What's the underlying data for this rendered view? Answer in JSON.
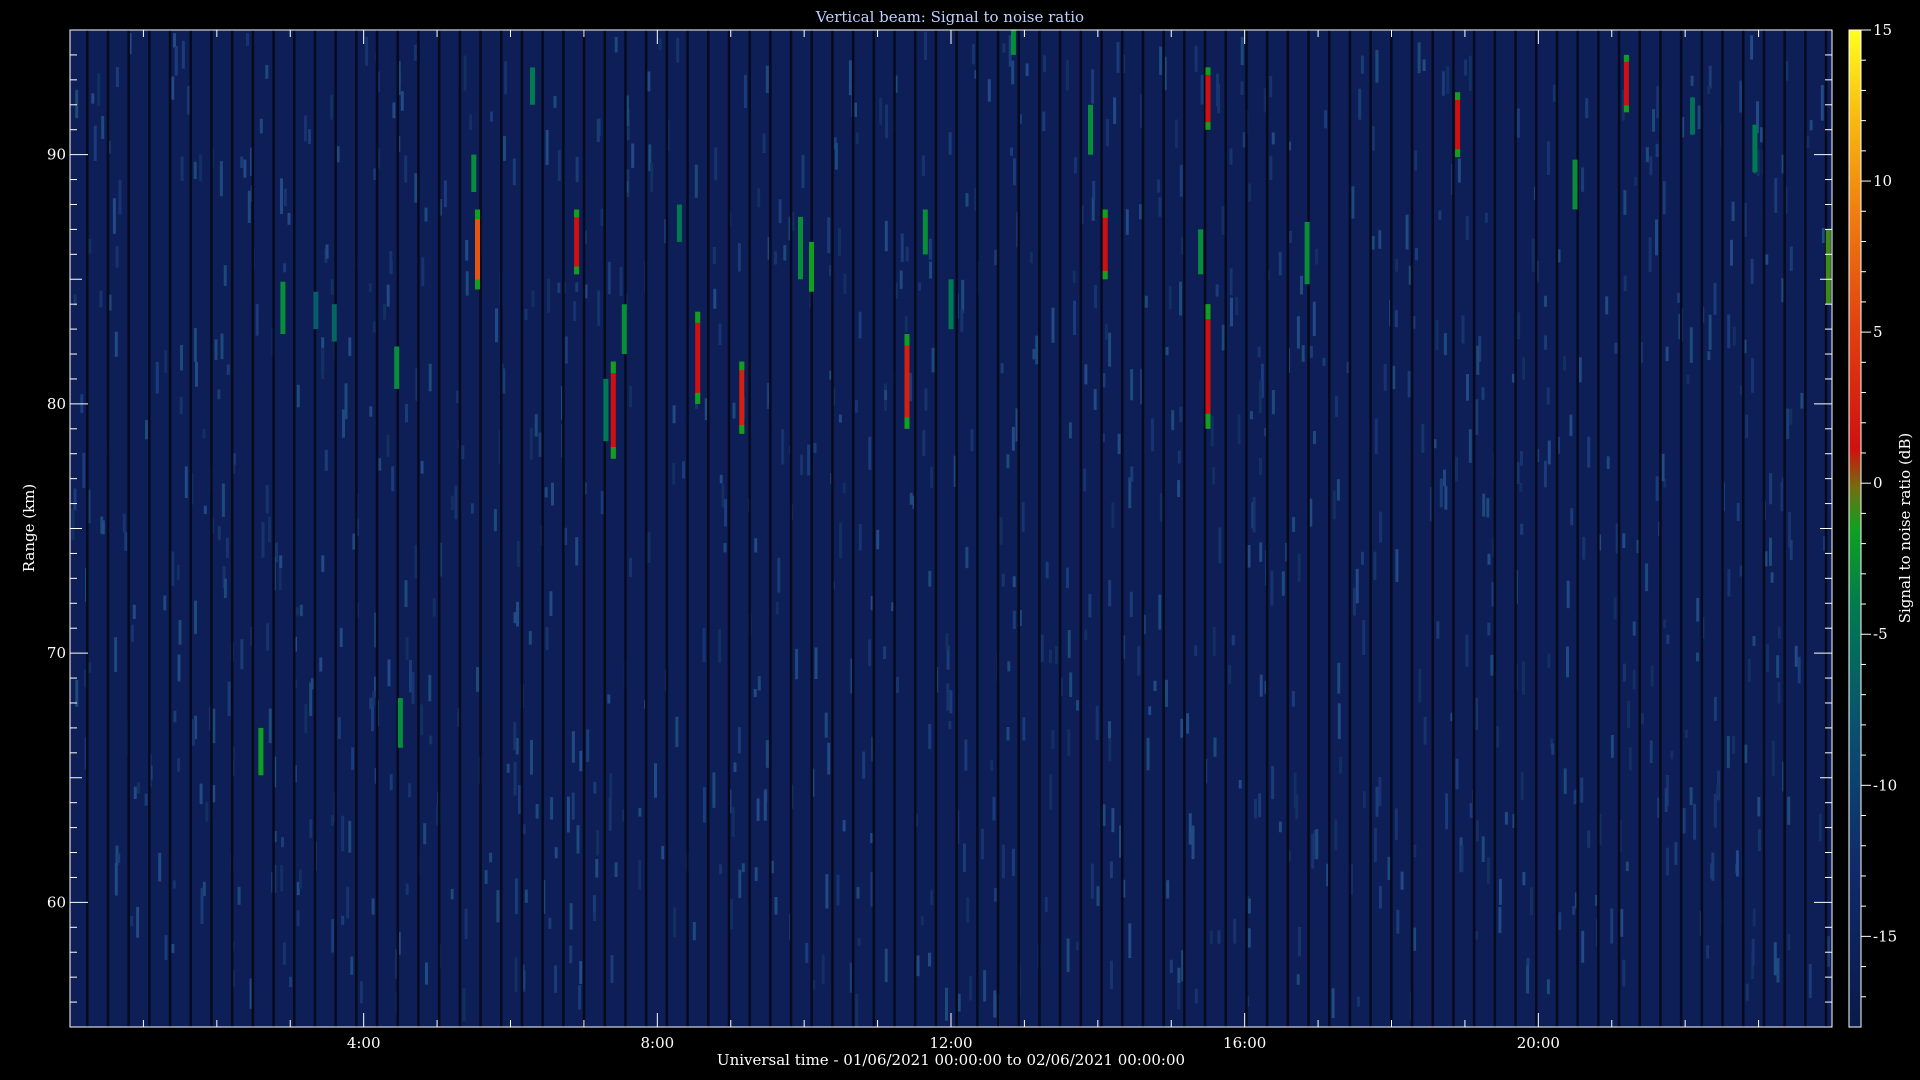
{
  "chart_data": {
    "type": "heatmap",
    "title": "Vertical beam: Signal to noise ratio",
    "xlabel": "Universal time - 01/06/2021 00:00:00 to 02/06/2021 00:00:00",
    "ylabel": "Range (km)",
    "colorbar_label": "Signal to noise ratio (dB)",
    "xlim_hours": [
      0,
      24
    ],
    "ylim_km": [
      55,
      95
    ],
    "x_ticks": [
      {
        "hour": 4,
        "label": "4:00"
      },
      {
        "hour": 8,
        "label": "8:00"
      },
      {
        "hour": 12,
        "label": "12:00"
      },
      {
        "hour": 16,
        "label": "16:00"
      },
      {
        "hour": 20,
        "label": "20:00"
      }
    ],
    "y_ticks": [
      {
        "km": 60,
        "label": "60"
      },
      {
        "km": 70,
        "label": "70"
      },
      {
        "km": 80,
        "label": "80"
      },
      {
        "km": 90,
        "label": "90"
      }
    ],
    "colorbar_range_db": [
      -18,
      15
    ],
    "colorbar_ticks": [
      {
        "db": 15,
        "label": "15"
      },
      {
        "db": 10,
        "label": "10"
      },
      {
        "db": 5,
        "label": "5"
      },
      {
        "db": 0,
        "label": "0"
      },
      {
        "db": -5,
        "label": "-5"
      },
      {
        "db": -10,
        "label": "-10"
      },
      {
        "db": -15,
        "label": "-15"
      }
    ],
    "background_snr_db": -16,
    "echoes": [
      {
        "hour": 2.6,
        "km_from": 65.1,
        "km_to": 67.0,
        "snr_db": -4
      },
      {
        "hour": 2.9,
        "km_from": 82.8,
        "km_to": 84.9,
        "snr_db": -5
      },
      {
        "hour": 3.35,
        "km_from": 83.0,
        "km_to": 84.5,
        "snr_db": -9
      },
      {
        "hour": 3.6,
        "km_from": 82.5,
        "km_to": 84.0,
        "snr_db": -8
      },
      {
        "hour": 4.45,
        "km_from": 80.6,
        "km_to": 82.3,
        "snr_db": -5
      },
      {
        "hour": 4.5,
        "km_from": 66.2,
        "km_to": 68.2,
        "snr_db": -5
      },
      {
        "hour": 5.5,
        "km_from": 88.5,
        "km_to": 90.0,
        "snr_db": -5
      },
      {
        "hour": 5.55,
        "km_from": 84.6,
        "km_to": 87.8,
        "snr_db": 4
      },
      {
        "hour": 6.3,
        "km_from": 92.0,
        "km_to": 93.5,
        "snr_db": -6
      },
      {
        "hour": 6.9,
        "km_from": 85.2,
        "km_to": 87.8,
        "snr_db": 0
      },
      {
        "hour": 7.3,
        "km_from": 78.5,
        "km_to": 81.0,
        "snr_db": -6
      },
      {
        "hour": 7.4,
        "km_from": 77.8,
        "km_to": 81.7,
        "snr_db": 0
      },
      {
        "hour": 7.55,
        "km_from": 82.0,
        "km_to": 84.0,
        "snr_db": -5
      },
      {
        "hour": 8.3,
        "km_from": 86.5,
        "km_to": 88.0,
        "snr_db": -6
      },
      {
        "hour": 8.55,
        "km_from": 80.0,
        "km_to": 83.7,
        "snr_db": 0
      },
      {
        "hour": 9.15,
        "km_from": 78.8,
        "km_to": 81.7,
        "snr_db": 1
      },
      {
        "hour": 9.95,
        "km_from": 85.0,
        "km_to": 87.5,
        "snr_db": -5
      },
      {
        "hour": 10.1,
        "km_from": 84.5,
        "km_to": 86.5,
        "snr_db": -4
      },
      {
        "hour": 11.4,
        "km_from": 79.0,
        "km_to": 82.8,
        "snr_db": 1
      },
      {
        "hour": 11.65,
        "km_from": 86.0,
        "km_to": 87.8,
        "snr_db": -5
      },
      {
        "hour": 12.0,
        "km_from": 83.0,
        "km_to": 85.0,
        "snr_db": -6
      },
      {
        "hour": 12.85,
        "km_from": 94.0,
        "km_to": 95.0,
        "snr_db": -5
      },
      {
        "hour": 13.9,
        "km_from": 90.0,
        "km_to": 92.0,
        "snr_db": -5
      },
      {
        "hour": 14.1,
        "km_from": 85.0,
        "km_to": 87.8,
        "snr_db": 0
      },
      {
        "hour": 15.4,
        "km_from": 85.2,
        "km_to": 87.0,
        "snr_db": -5
      },
      {
        "hour": 15.5,
        "km_from": 79.0,
        "km_to": 84.0,
        "snr_db": 0
      },
      {
        "hour": 15.5,
        "km_from": 91.0,
        "km_to": 93.5,
        "snr_db": 0
      },
      {
        "hour": 16.85,
        "km_from": 84.8,
        "km_to": 87.3,
        "snr_db": -5
      },
      {
        "hour": 18.9,
        "km_from": 89.9,
        "km_to": 92.5,
        "snr_db": 0
      },
      {
        "hour": 20.5,
        "km_from": 87.8,
        "km_to": 89.8,
        "snr_db": -5
      },
      {
        "hour": 21.2,
        "km_from": 91.7,
        "km_to": 94.0,
        "snr_db": 0
      },
      {
        "hour": 22.1,
        "km_from": 90.8,
        "km_to": 92.3,
        "snr_db": -7
      },
      {
        "hour": 22.95,
        "km_from": 89.3,
        "km_to": 91.2,
        "snr_db": -6
      },
      {
        "hour": 23.95,
        "km_from": 84.0,
        "km_to": 87.0,
        "snr_db": -3
      }
    ]
  },
  "colors": {
    "background": "#000000",
    "plot_background": "#0e1e56",
    "title": "#bcd0ff",
    "text": "#ffffff",
    "axis": "#ffffff"
  }
}
